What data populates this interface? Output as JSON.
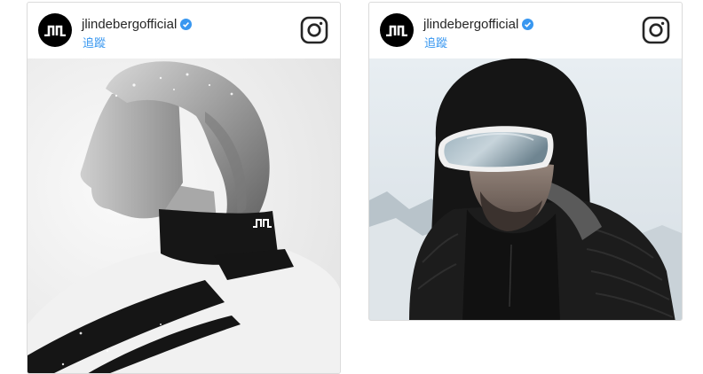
{
  "posts": [
    {
      "account": {
        "username": "jlindebergofficial",
        "verified": true,
        "follow_label": "追蹤"
      },
      "header_icons": {
        "avatar": "j-lindeberg-logo",
        "verified": "verified-badge-icon",
        "platform": "instagram-icon"
      },
      "photo": {
        "subject": "woman-in-ski-jacket",
        "logo_text": "JL"
      }
    },
    {
      "account": {
        "username": "jlindebergofficial",
        "verified": true,
        "follow_label": "追蹤"
      },
      "header_icons": {
        "avatar": "j-lindeberg-logo",
        "verified": "verified-badge-icon",
        "platform": "instagram-icon"
      },
      "photo": {
        "subject": "man-in-hood-with-goggles"
      }
    }
  ],
  "colors": {
    "link_blue": "#3897f0",
    "verified_blue": "#3897f0",
    "text": "#262626",
    "border": "#dbdbdb"
  }
}
